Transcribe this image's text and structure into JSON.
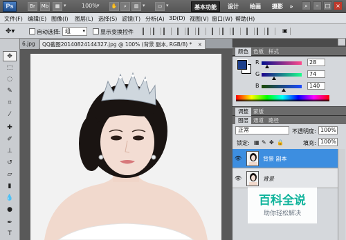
{
  "appbar": {
    "logo": "Ps",
    "zoom": "100%",
    "workspaces": [
      "基本功能",
      "设计",
      "绘画",
      "摄影"
    ],
    "overflow": "»"
  },
  "menus": [
    "文件(F)",
    "编辑(E)",
    "图像(I)",
    "图层(L)",
    "选择(S)",
    "滤镜(T)",
    "分析(A)",
    "3D(D)",
    "视图(V)",
    "窗口(W)",
    "帮助(H)"
  ],
  "options": {
    "auto_select_label": "自动选择:",
    "auto_select_value": "组",
    "show_transform_label": "显示变换控件"
  },
  "doc_tabs": {
    "tab1": "6.jpg",
    "tab2": "QQ截图20140824144327.jpg @ 100% (背景 副本, RGB/8) *",
    "close": "×"
  },
  "color_panel": {
    "tabs": [
      "颜色",
      "色板",
      "样式"
    ],
    "channels": [
      {
        "label": "R",
        "value": "28"
      },
      {
        "label": "G",
        "value": "74"
      },
      {
        "label": "B",
        "value": "140"
      }
    ],
    "foreground": "#1d3f8b"
  },
  "adjust_panel": {
    "tabs": [
      "调整",
      "蒙版"
    ]
  },
  "layers_panel": {
    "tabs": [
      "图层",
      "通道",
      "路径"
    ],
    "blend_mode": "正常",
    "opacity_label": "不透明度:",
    "opacity_value": "100%",
    "lock_label": "锁定:",
    "fill_label": "填充:",
    "fill_value": "100%",
    "layers": [
      {
        "name": "背景 副本"
      },
      {
        "name": "背景"
      }
    ]
  },
  "watermark": {
    "title": "百科全说",
    "subtitle": "助你轻松解决"
  },
  "colors": {
    "accent": "#3d8ee0",
    "watermark": "#0fb39b"
  }
}
